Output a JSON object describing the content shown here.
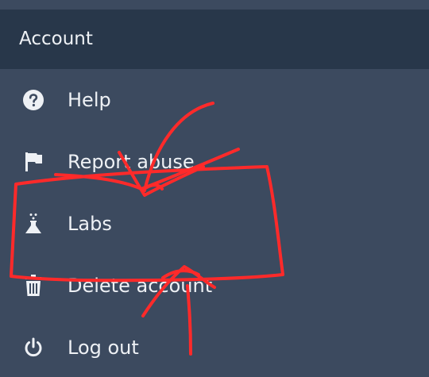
{
  "section": {
    "title": "Account"
  },
  "menu": {
    "items": [
      {
        "label": "Help",
        "icon": "help-circle-icon"
      },
      {
        "label": "Report abuse",
        "icon": "flag-icon"
      },
      {
        "label": "Labs",
        "icon": "flask-icon"
      },
      {
        "label": "Delete account",
        "icon": "trash-icon"
      },
      {
        "label": "Log out",
        "icon": "power-icon"
      }
    ]
  },
  "colors": {
    "background": "#3c4a5f",
    "header_background": "#28374a",
    "text": "#eef1f5",
    "annotation": "#ff2a2a"
  }
}
